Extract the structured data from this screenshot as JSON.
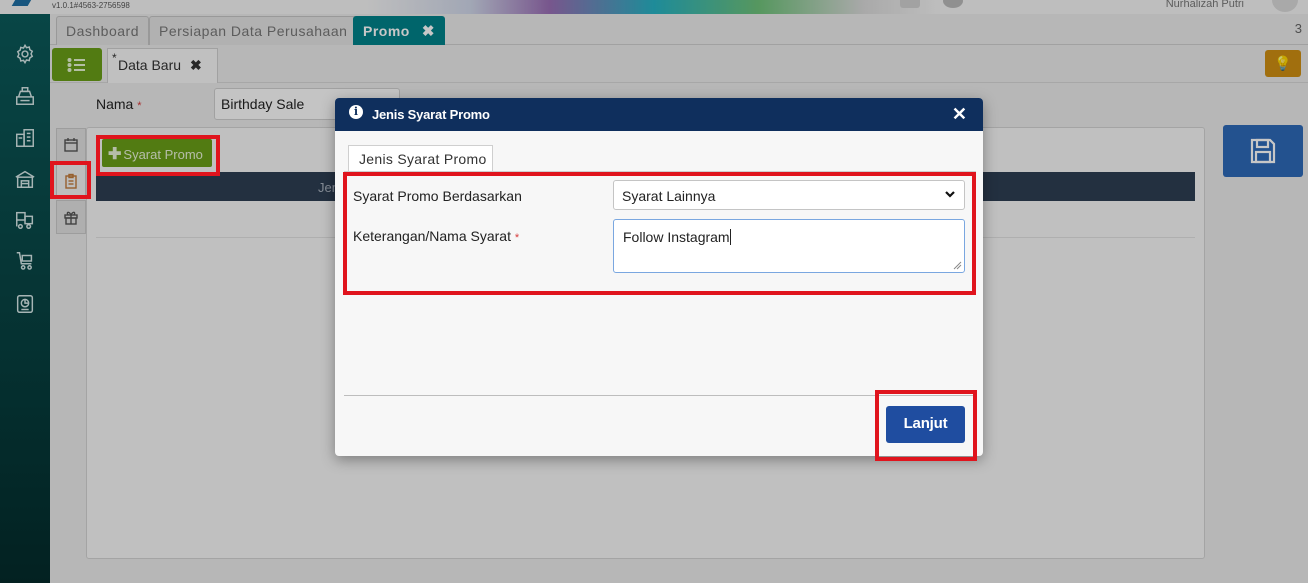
{
  "header": {
    "version": "v1.0.1#4563-2756598",
    "user_name": "Nurhalizah Putri"
  },
  "tabs": [
    {
      "label": "Dashboard",
      "active": false
    },
    {
      "label": "Persiapan Data Perusahaan",
      "active": false
    },
    {
      "label": "Promo",
      "active": true,
      "close": "✖"
    }
  ],
  "tab_count": "3",
  "subtab": {
    "star": "*",
    "label": "Data Baru",
    "close": "✖"
  },
  "form": {
    "nama_label": "Nama",
    "required_mark": "*",
    "nama_value": "Birthday Sale"
  },
  "panel": {
    "add_button": "Syarat Promo",
    "table_header_fragment": "Jen"
  },
  "modal": {
    "title": "Jenis Syarat Promo",
    "info_glyph": "i",
    "close": "✕",
    "tab_label": "Jenis Syarat Promo",
    "field1_label": "Syarat Promo Berdasarkan",
    "field1_value": "Syarat Lainnya",
    "field2_label": "Keterangan/Nama Syarat",
    "field2_required": "*",
    "field2_value": "Follow Instagram",
    "next_button": "Lanjut"
  },
  "colors": {
    "sidebar": "#0b5a5a",
    "active_tab": "#00828a",
    "green_button": "#6a9e18",
    "modal_header": "#0f2f5d",
    "primary_button": "#1f4da0",
    "save_button": "#2d69b8",
    "highlight": "#e0141d"
  },
  "icons": {
    "sidebar": [
      "settings-icon",
      "cash-register-icon",
      "building-icon",
      "warehouse-icon",
      "forklift-icon",
      "cart-icon",
      "report-icon"
    ],
    "left_tabs": [
      "calendar-icon",
      "clipboard-icon",
      "gift-icon"
    ]
  }
}
